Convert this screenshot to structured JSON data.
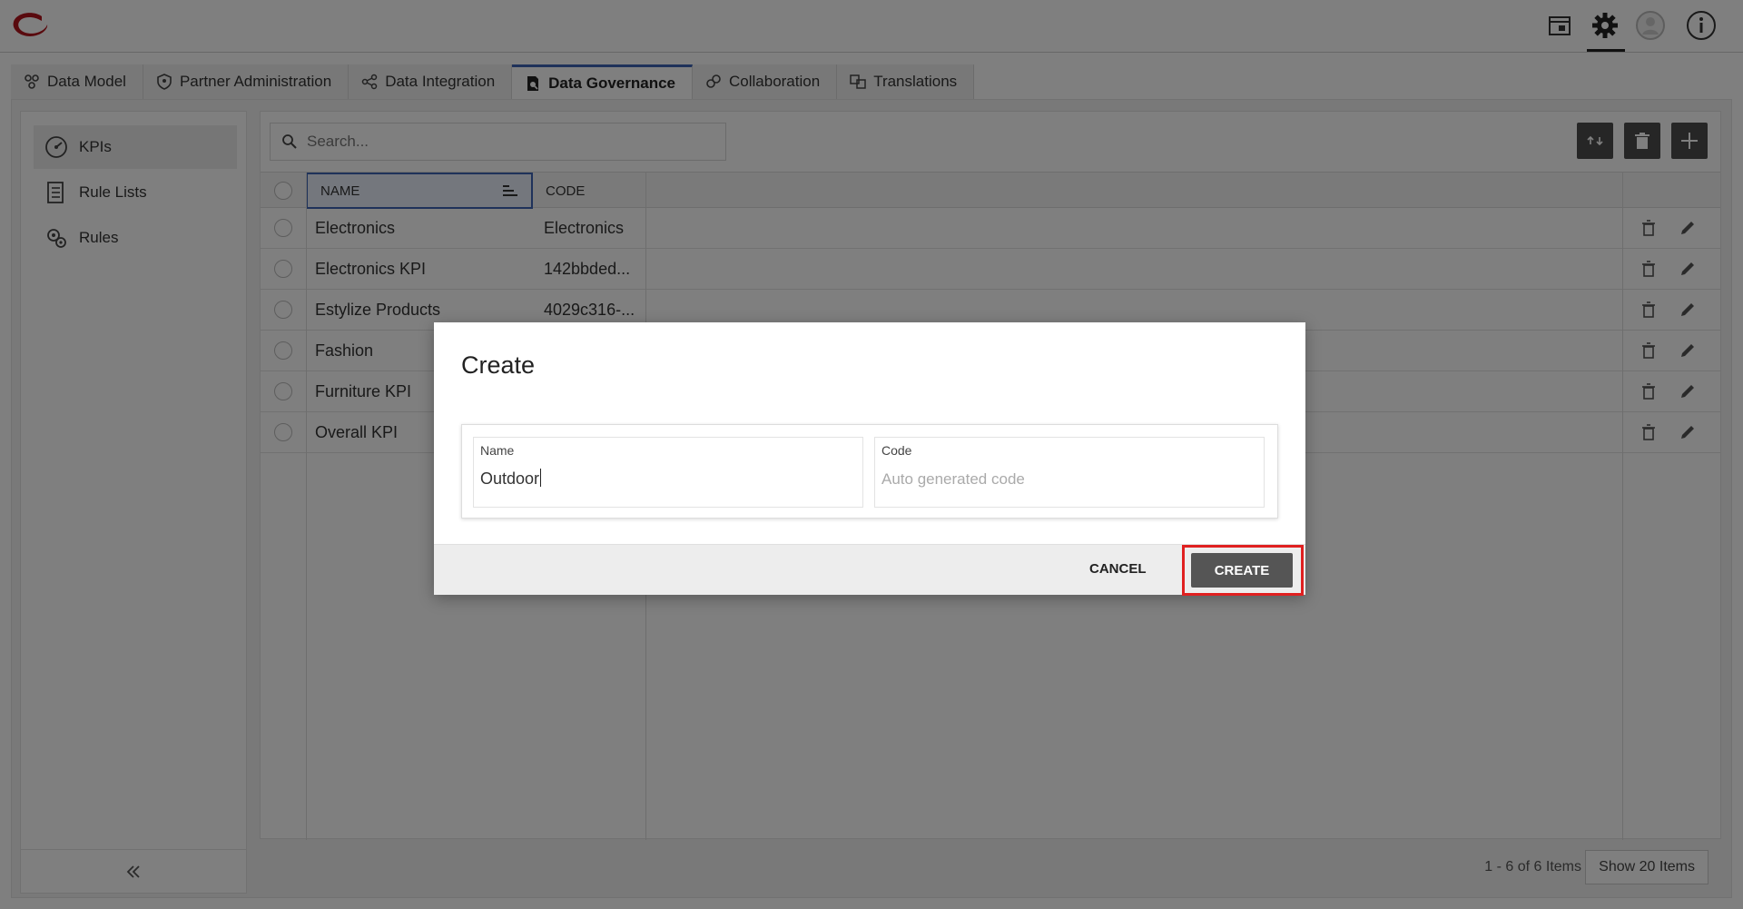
{
  "topbar": {
    "icons": [
      "logo",
      "window-icon",
      "gear-icon",
      "user-avatar-icon",
      "info-icon"
    ]
  },
  "tabs": [
    {
      "label": "Data Model",
      "icon": "data-model-icon",
      "active": false
    },
    {
      "label": "Partner Administration",
      "icon": "shield-icon",
      "active": false
    },
    {
      "label": "Data Integration",
      "icon": "share-icon",
      "active": false
    },
    {
      "label": "Data Governance",
      "icon": "governance-icon",
      "active": true
    },
    {
      "label": "Collaboration",
      "icon": "collaboration-icon",
      "active": false
    },
    {
      "label": "Translations",
      "icon": "translations-icon",
      "active": false
    }
  ],
  "sidebar": {
    "items": [
      {
        "label": "KPIs",
        "icon": "gauge-icon",
        "active": true
      },
      {
        "label": "Rule Lists",
        "icon": "list-icon",
        "active": false
      },
      {
        "label": "Rules",
        "icon": "rules-gear-icon",
        "active": false
      }
    ]
  },
  "search": {
    "placeholder": "Search..."
  },
  "grid": {
    "columns": [
      "NAME",
      "CODE"
    ],
    "rows": [
      {
        "name": "Electronics",
        "code": "Electronics"
      },
      {
        "name": "Electronics KPI",
        "code": "142bbded..."
      },
      {
        "name": "Estylize Products",
        "code": "4029c316-..."
      },
      {
        "name": "Fashion",
        "code": ""
      },
      {
        "name": "Furniture KPI",
        "code": ""
      },
      {
        "name": "Overall KPI",
        "code": ""
      }
    ]
  },
  "footer": {
    "pager": "1 - 6 of 6 Items",
    "show_items": "Show 20 Items"
  },
  "modal": {
    "title": "Create",
    "name_label": "Name",
    "name_value": "Outdoor",
    "code_label": "Code",
    "code_placeholder": "Auto generated code",
    "cancel_label": "CANCEL",
    "create_label": "CREATE",
    "highlight_color": "#e02020"
  }
}
